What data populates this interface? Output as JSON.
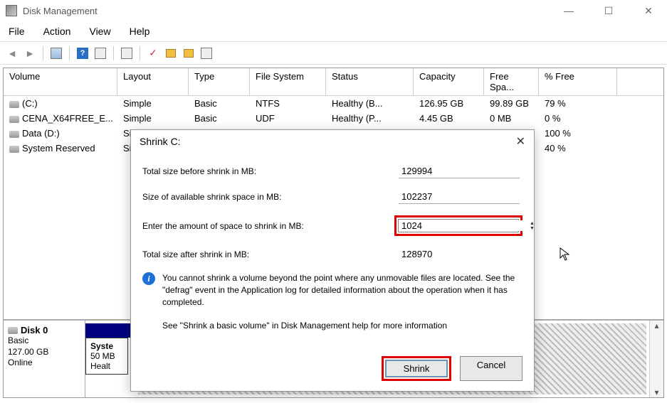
{
  "window": {
    "title": "Disk Management"
  },
  "menu": {
    "file": "File",
    "action": "Action",
    "view": "View",
    "help": "Help"
  },
  "columns": {
    "volume": "Volume",
    "layout": "Layout",
    "type": "Type",
    "fs": "File System",
    "status": "Status",
    "capacity": "Capacity",
    "free": "Free Spa...",
    "pct": "% Free"
  },
  "rows": [
    {
      "volume": "(C:)",
      "layout": "Simple",
      "type": "Basic",
      "fs": "NTFS",
      "status": "Healthy (B...",
      "capacity": "126.95 GB",
      "free": "99.89 GB",
      "pct": "79 %"
    },
    {
      "volume": "CENA_X64FREE_E...",
      "layout": "Simple",
      "type": "Basic",
      "fs": "UDF",
      "status": "Healthy (P...",
      "capacity": "4.45 GB",
      "free": "0 MB",
      "pct": "0 %"
    },
    {
      "volume": "Data (D:)",
      "layout": "Si",
      "type": "",
      "fs": "",
      "status": "",
      "capacity": "",
      "free": "",
      "pct": "100 %"
    },
    {
      "volume": "System Reserved",
      "layout": "Si",
      "type": "",
      "fs": "",
      "status": "",
      "capacity": "",
      "free": "",
      "pct": "40 %"
    }
  ],
  "diskmap": {
    "title": "Disk 0",
    "type": "Basic",
    "size": "127.00 GB",
    "state": "Online",
    "part0_name": "Syste",
    "part0_size": "50 MB",
    "part0_status": "Healt"
  },
  "dialog": {
    "title": "Shrink C:",
    "label_total_before": "Total size before shrink in MB:",
    "val_total_before": "129994",
    "label_avail": "Size of available shrink space in MB:",
    "val_avail": "102237",
    "label_amount": "Enter the amount of space to shrink in MB:",
    "val_amount": "1024",
    "label_total_after": "Total size after shrink in MB:",
    "val_total_after": "128970",
    "info_text": "You cannot shrink a volume beyond the point where any unmovable files are located. See the \"defrag\" event in the Application log for detailed information about the operation when it has completed.",
    "help_text": "See \"Shrink a basic volume\" in Disk Management help for more information",
    "btn_shrink": "Shrink",
    "btn_cancel": "Cancel"
  }
}
